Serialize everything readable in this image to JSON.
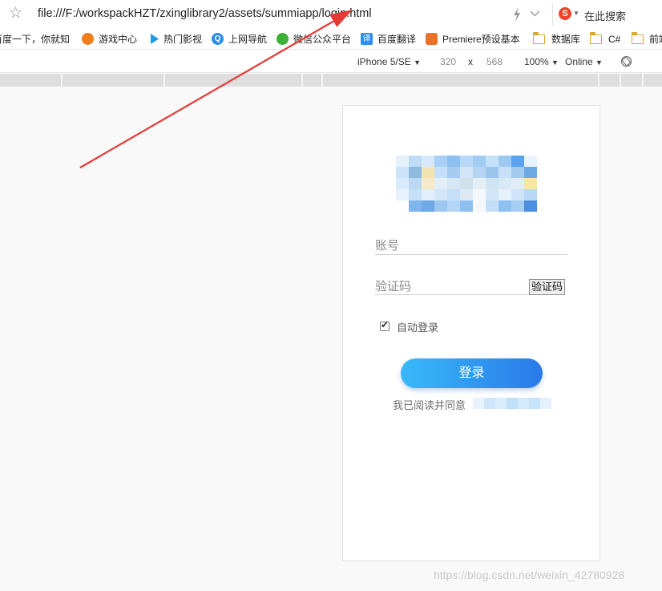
{
  "browser": {
    "url": "file:///F:/workspackHZT/zxinglibrary2/assets/summiapp/login.html",
    "star_icon": "star-icon",
    "search_engine_letter": "S",
    "search_placeholder": "在此搜索"
  },
  "bookmarks": {
    "items": [
      {
        "label": "百度一下，你就知"
      },
      {
        "label": "游戏中心",
        "icon": "game-center-icon",
        "color": "#f07c1a"
      },
      {
        "label": "热门影视",
        "icon": "play-icon",
        "color": "#1e9be8"
      },
      {
        "label": "上网导航",
        "icon": "q-navigation-icon",
        "color": "#2b8de8",
        "letter": "Q"
      },
      {
        "label": "微信公众平台",
        "icon": "wechat-icon",
        "color": "#3cb034"
      },
      {
        "label": "百度翻译",
        "icon": "translate-icon",
        "color": "#2f8ef0",
        "letter": "译"
      },
      {
        "label": "Premiere预设基本",
        "icon": "premiere-icon",
        "color": "#e8732a"
      },
      {
        "label": "数据库",
        "icon": "folder-icon"
      },
      {
        "label": "C#",
        "icon": "folder-icon"
      },
      {
        "label": "前端",
        "icon": "folder-icon"
      }
    ]
  },
  "device_toolbar": {
    "device": "iPhone 5/SE",
    "width": "320",
    "times": "x",
    "height": "568",
    "zoom": "100%",
    "network": "Online",
    "caret": "▼"
  },
  "login_page": {
    "logo_mosaic_colors": [
      "#e6f1fb",
      "#bfdcf6",
      "#d8eafa",
      "#a9d0f4",
      "#8cc0f0",
      "#b7d8f6",
      "#a0cbf3",
      "#c5e1f8",
      "#9dc9f3",
      "#5aa3ec",
      "#e8f3fd",
      "#ffffff",
      "#cde4f8",
      "#8ebae0",
      "#f3e3b0",
      "#c4dff7",
      "#a6cdef",
      "#d2e6f7",
      "#b5d5f2",
      "#9cc6ee",
      "#c9e1f6",
      "#a3cbef",
      "#6ea9e6",
      "#ffffff",
      "#d9ebfa",
      "#bcd8f2",
      "#f5e9c9",
      "#e4eef6",
      "#d6e7f3",
      "#cfe1ea",
      "#e5eef4",
      "#cfe3f2",
      "#d8e8f5",
      "#e1ecf6",
      "#f6e6a8",
      "#ffffff",
      "#e8f2fc",
      "#c8e0f7",
      "#e2eef9",
      "#d2e6f8",
      "#c5dff7",
      "#dfe9f3",
      "#f4f8fc",
      "#d3e6f8",
      "#e6f1fb",
      "#cfe4f8",
      "#b8d8f6",
      "#ffffff",
      "#ffffff",
      "#7fb5ec",
      "#6ea9e8",
      "#9cc8f2",
      "#b5d5f6",
      "#8ec0ef",
      "#f5f9fd",
      "#c4def7",
      "#8dbff0",
      "#a6cdf3",
      "#4b8fe0",
      "#ffffff"
    ],
    "account_placeholder": "账号",
    "code_placeholder": "验证码",
    "code_button": "验证码",
    "auto_login_label": "自动登录",
    "auto_login_checked": true,
    "checkmark": "✔",
    "login_button": "登录",
    "login_gradient": [
      "#38b9f9",
      "#2a7ae8"
    ],
    "agreement_text": "我已阅读并同意",
    "agreement_link_mosaic_colors": [
      "#e8f3fd",
      "#cfe6fa",
      "#d9ecfb",
      "#bfe0f9",
      "#d4e9fb",
      "#c7e3f9",
      "#e4f1fd"
    ]
  },
  "watermark": "https://blog.csdn.net/weixin_42780928",
  "annotation_color": "#e53935"
}
